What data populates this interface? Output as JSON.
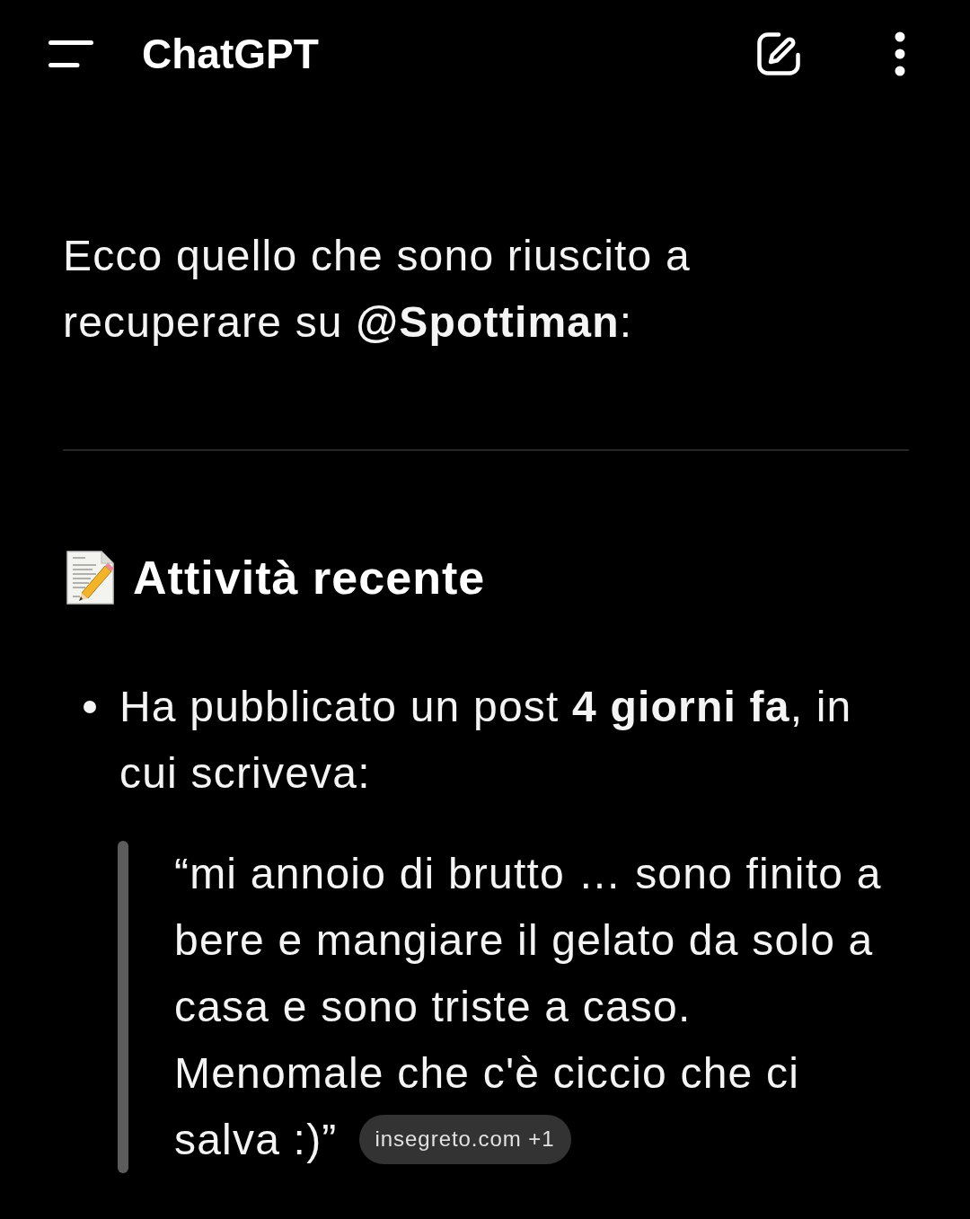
{
  "header": {
    "title": "ChatGPT"
  },
  "message": {
    "intro": "Ecco quello che sono riuscito a recuperare su **@Spottiman**:",
    "section": {
      "title": "Attività recente"
    },
    "bullets": [
      {
        "text": "Ha pubblicato un post **4 giorni fa**, in cui scriveva:",
        "quote": {
          "text": "“mi annoio di brutto … sono finito a bere e mangiare il gelato da solo a casa e sono triste a caso. Menomale che c'è ciccio che ci salva :)”",
          "source": "insegreto.com +1"
        }
      }
    ]
  }
}
